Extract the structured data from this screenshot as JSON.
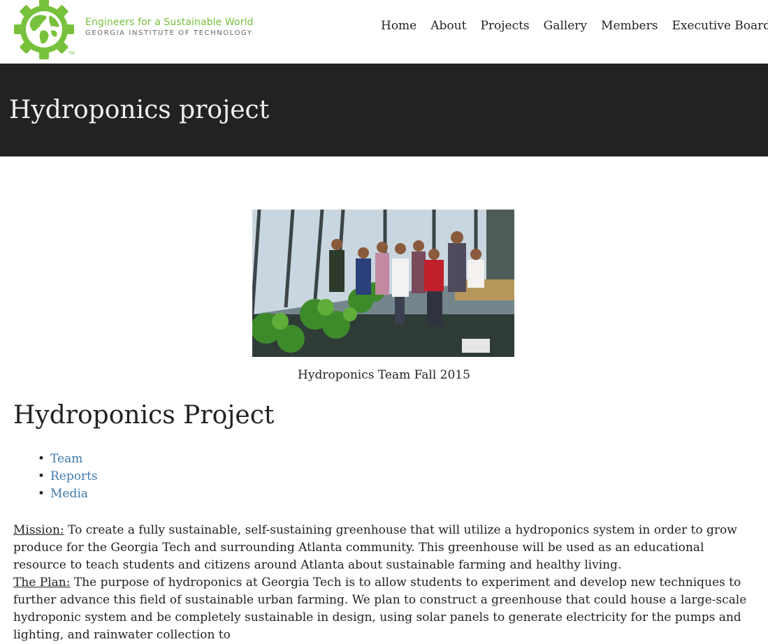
{
  "header": {
    "logo": {
      "line1": "Engineers for a Sustainable World",
      "line2": "GEORGIA INSTITUTE OF TECHNOLOGY",
      "tm": "TM",
      "color": "#78c13c"
    },
    "nav": [
      "Home",
      "About",
      "Projects",
      "Gallery",
      "Members",
      "Executive Board Me"
    ]
  },
  "banner": {
    "title": "Hydroponics project",
    "background": "#222222"
  },
  "photo": {
    "caption": "Hydroponics Team Fall 2015"
  },
  "section": {
    "title": "Hydroponics Project",
    "links": [
      " Team",
      "  Reports",
      " Media"
    ],
    "link_color": "#3f7ab0"
  },
  "body": {
    "mission_label": "Mission:",
    "mission_text": " To create a fully sustainable, self-sustaining greenhouse that will utilize a hydroponics system in order to grow produce for the Georgia Tech and surrounding Atlanta community. This greenhouse will be used as an educational resource to teach students and citizens around Atlanta about sustainable farming and healthy living.",
    "plan_label": "The Plan:",
    "plan_text": " The purpose of hydroponics at Georgia Tech is to allow students to experiment and develop new techniques to further advance this field of sustainable urban farming. We plan to construct a greenhouse that could house a large-scale hydroponic system and  be completely sustainable in design, using solar panels to generate electricity for the pumps and lighting, and rainwater collection to"
  }
}
